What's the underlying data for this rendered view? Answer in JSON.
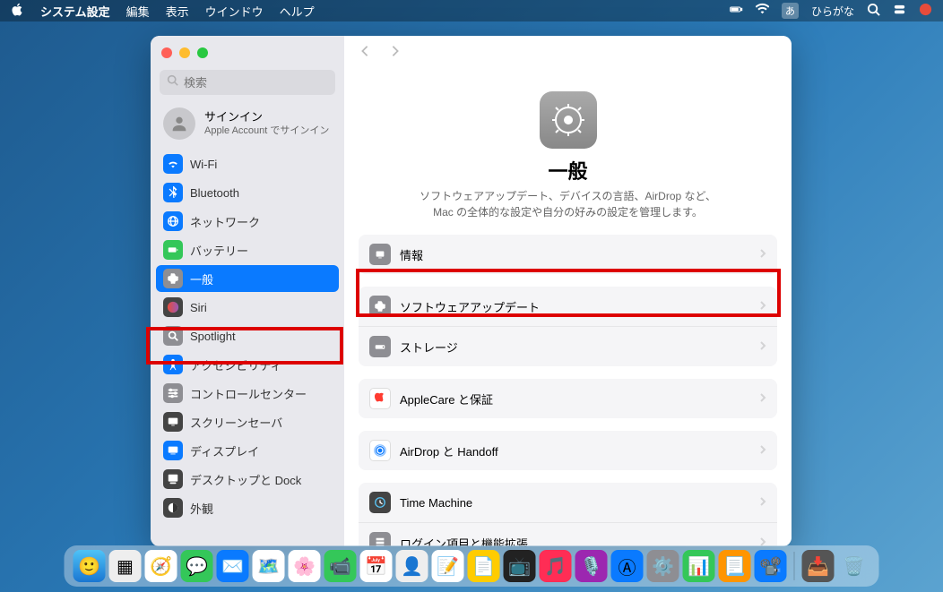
{
  "menubar": {
    "app": "システム設定",
    "items": [
      "編集",
      "表示",
      "ウインドウ",
      "ヘルプ"
    ],
    "input_method_badge": "あ",
    "input_method_label": "ひらがな"
  },
  "sidebar": {
    "search_placeholder": "検索",
    "signin": {
      "title": "サインイン",
      "subtitle": "Apple Account でサインイン"
    },
    "items": [
      {
        "label": "Wi-Fi",
        "icon": "wifi",
        "bg": "bg-blue"
      },
      {
        "label": "Bluetooth",
        "icon": "bluetooth",
        "bg": "bg-blue"
      },
      {
        "label": "ネットワーク",
        "icon": "globe",
        "bg": "bg-blue"
      },
      {
        "label": "バッテリー",
        "icon": "battery",
        "bg": "bg-green"
      },
      {
        "label": "一般",
        "icon": "gear",
        "bg": "bg-gray",
        "selected": true
      },
      {
        "label": "Siri",
        "icon": "siri",
        "bg": "bg-dark"
      },
      {
        "label": "Spotlight",
        "icon": "search",
        "bg": "bg-gray"
      },
      {
        "label": "アクセシビリティ",
        "icon": "accessibility",
        "bg": "bg-blue"
      },
      {
        "label": "コントロールセンター",
        "icon": "sliders",
        "bg": "bg-gray"
      },
      {
        "label": "スクリーンセーバ",
        "icon": "screensaver",
        "bg": "bg-dark"
      },
      {
        "label": "ディスプレイ",
        "icon": "display",
        "bg": "bg-blue"
      },
      {
        "label": "デスクトップと Dock",
        "icon": "dock",
        "bg": "bg-dark"
      },
      {
        "label": "外観",
        "icon": "appearance",
        "bg": "bg-dark"
      }
    ]
  },
  "main": {
    "hero_title": "一般",
    "hero_desc_l1": "ソフトウェアアップデート、デバイスの言語、AirDrop など、",
    "hero_desc_l2": "Mac の全体的な設定や自分の好みの設定を管理します。",
    "groups": [
      {
        "rows": [
          {
            "label": "情報",
            "icon": "info",
            "bg": "bg-gray",
            "highlighted": true
          }
        ]
      },
      {
        "rows": [
          {
            "label": "ソフトウェアアップデート",
            "icon": "gear",
            "bg": "bg-gray"
          },
          {
            "label": "ストレージ",
            "icon": "storage",
            "bg": "bg-gray"
          }
        ]
      },
      {
        "rows": [
          {
            "label": "AppleCare と保証",
            "icon": "applecare",
            "bg": "bg-white"
          }
        ]
      },
      {
        "rows": [
          {
            "label": "AirDrop と Handoff",
            "icon": "airdrop",
            "bg": "bg-white"
          }
        ]
      },
      {
        "rows": [
          {
            "label": "Time Machine",
            "icon": "timemachine",
            "bg": "bg-dark"
          },
          {
            "label": "ログイン項目と機能拡張",
            "icon": "login",
            "bg": "bg-gray"
          }
        ]
      }
    ]
  },
  "highlights": {
    "sidebar_item_index": 4,
    "main_row": "情報"
  }
}
